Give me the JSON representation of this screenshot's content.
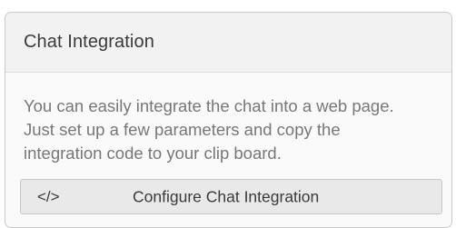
{
  "panel": {
    "title": "Chat Integration",
    "description": "You can easily integrate the chat into a web page. Just set up a few parameters and copy the integration code to your clip board.",
    "button": {
      "icon": "</>",
      "icon_name": "code-icon",
      "label": "Configure Chat Integration"
    }
  }
}
